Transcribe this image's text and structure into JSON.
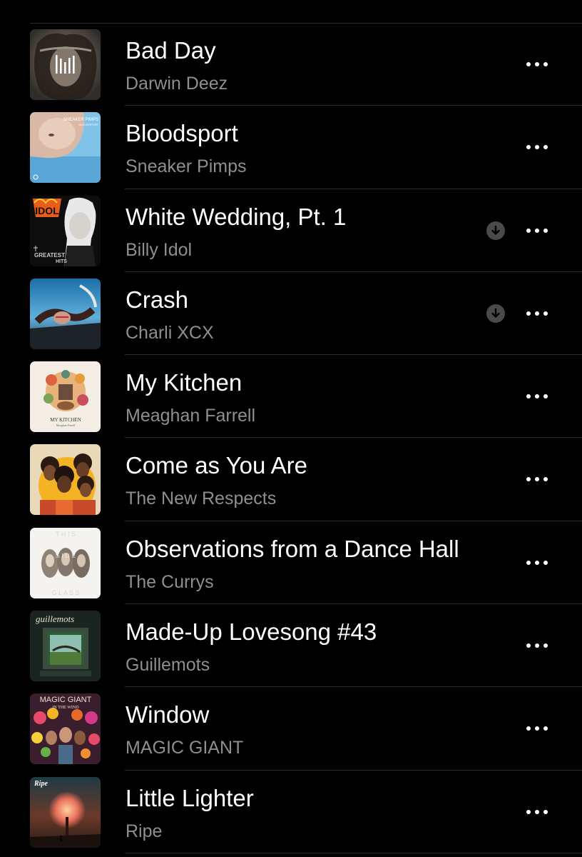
{
  "tracks": [
    {
      "title": "Bad Day",
      "artist": "Darwin Deez",
      "downloaded": false,
      "now_playing": true,
      "art_icon": "album-art-bad-day"
    },
    {
      "title": "Bloodsport",
      "artist": "Sneaker Pimps",
      "downloaded": false,
      "now_playing": false,
      "art_icon": "album-art-bloodsport",
      "art_text": [
        "SNEAKER PIMPS",
        "BLOODSPORT"
      ]
    },
    {
      "title": "White Wedding, Pt. 1",
      "artist": "Billy Idol",
      "downloaded": true,
      "now_playing": false,
      "art_icon": "album-art-billy-idol-greatest-hits",
      "art_text": [
        "IDOL",
        "GREATEST",
        "HITS"
      ]
    },
    {
      "title": "Crash",
      "artist": "Charli XCX",
      "downloaded": true,
      "now_playing": false,
      "art_icon": "album-art-crash"
    },
    {
      "title": "My Kitchen",
      "artist": "Meaghan Farrell",
      "downloaded": false,
      "now_playing": false,
      "art_icon": "album-art-my-kitchen",
      "art_text": [
        "MY KITCHEN",
        "Meaghan Farrell"
      ]
    },
    {
      "title": "Come as You Are",
      "artist": "The New Respects",
      "downloaded": false,
      "now_playing": false,
      "art_icon": "album-art-come-as-you-are"
    },
    {
      "title": "Observations from a Dance Hall",
      "artist": "The Currys",
      "downloaded": false,
      "now_playing": false,
      "art_icon": "album-art-this-side-glass",
      "art_text": [
        "T H I S",
        "S I D E",
        "G L A S S"
      ]
    },
    {
      "title": "Made-Up Lovesong #43",
      "artist": "Guillemots",
      "downloaded": false,
      "now_playing": false,
      "art_icon": "album-art-guillemots",
      "art_text": [
        "guillemots"
      ]
    },
    {
      "title": "Window",
      "artist": "MAGIC GIANT",
      "downloaded": false,
      "now_playing": false,
      "art_icon": "album-art-magic-giant",
      "art_text": [
        "MAGIC GIANT",
        "IN THE WIND"
      ]
    },
    {
      "title": "Little Lighter",
      "artist": "Ripe",
      "downloaded": false,
      "now_playing": false,
      "art_icon": "album-art-little-lighter",
      "art_text": [
        "Ripe"
      ]
    }
  ],
  "icons": {
    "more": "ellipsis-icon",
    "download": "download-arrow-icon",
    "now_playing": "equalizer-bars-icon"
  },
  "colors": {
    "background": "#000000",
    "title": "#ffffff",
    "subtitle": "#8e8e93",
    "divider": "#2a2a2a",
    "download_badge": "#4a4a4c"
  }
}
